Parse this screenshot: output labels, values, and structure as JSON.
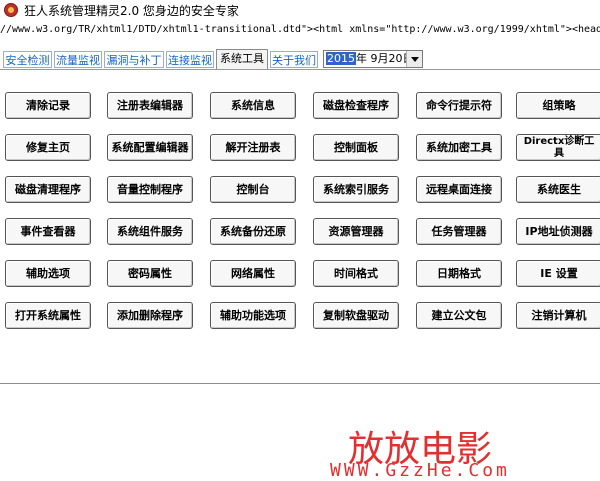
{
  "window": {
    "title": "狂人系统管理精灵2.0 您身边的安全专家",
    "source_line": "//www.w3.org/TR/xhtml1/DTD/xhtml1-transitional.dtd\"><html xmlns=\"http://www.w3.org/1999/xhtml\"><head><meta http-eq"
  },
  "tabs": [
    {
      "label": "安全检测",
      "active": false
    },
    {
      "label": "流量监视",
      "active": false
    },
    {
      "label": "漏洞与补丁",
      "active": false
    },
    {
      "label": "连接监视",
      "active": false
    },
    {
      "label": "系统工具",
      "active": true
    },
    {
      "label": "关于我们",
      "active": false
    }
  ],
  "date_picker": {
    "year": "2015",
    "rest": "年 9月20日"
  },
  "tool_buttons": [
    [
      "清除记录",
      "注册表编辑器",
      "系统信息",
      "磁盘检查程序",
      "命令行提示符",
      "组策略"
    ],
    [
      "修复主页",
      "系统配置编辑器",
      "解开注册表",
      "控制面板",
      "系统加密工具",
      "Directx诊断工具"
    ],
    [
      "磁盘清理程序",
      "音量控制程序",
      "控制台",
      "系统索引服务",
      "远程桌面连接",
      "系统医生"
    ],
    [
      "事件查看器",
      "系统组件服务",
      "系统备份还原",
      "资源管理器",
      "任务管理器",
      "IP地址侦测器"
    ],
    [
      "辅助选项",
      "密码属性",
      "网络属性",
      "时间格式",
      "日期格式",
      "IE 设置"
    ],
    [
      "打开系统属性",
      "添加删除程序",
      "辅助功能选项",
      "复制软盘驱动",
      "建立公文包",
      "注销计算机"
    ]
  ],
  "watermark": {
    "cn": "放放电影",
    "url": "WWW.GzzHe.Com"
  }
}
